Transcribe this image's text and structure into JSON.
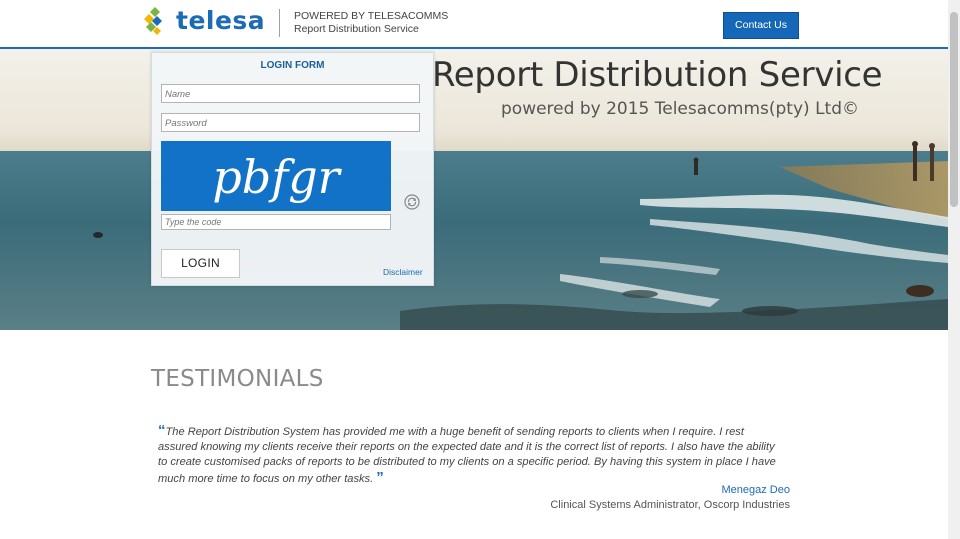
{
  "header": {
    "logo_text": "telesa",
    "powered_line1": "POWERED BY TELESACOMMS",
    "powered_line2": "Report Distribution Service",
    "contact_label": "Contact Us"
  },
  "hero": {
    "title": "Report Distribution Service",
    "subtitle": "powered by 2015 Telesacomms(pty) Ltd©"
  },
  "login_form": {
    "title": "LOGIN FORM",
    "name_placeholder": "Name",
    "password_placeholder": "Password",
    "captcha_text": "pbfgr",
    "code_placeholder": "Type the code",
    "login_label": "LOGIN",
    "disclaimer_label": "Disclaimer"
  },
  "testimonials": {
    "title": "TESTIMONIALS",
    "quote": "The Report Distribution System has provided me with a huge benefit of sending reports to clients when I require. I rest assured knowing my clients receive their reports on the expected date and it is the correct list of reports. I also have the ability to create customised packs of reports to be distributed to my clients on a specific period. By having this system in place I have much more time to focus on my other tasks.",
    "author": "Menegaz Deo",
    "author_role": "Clinical Systems Administrator, Oscorp Industries"
  },
  "colors": {
    "brand_blue": "#1c6bb5",
    "button_blue": "#1568b8",
    "captcha_bg": "#1172c7"
  }
}
